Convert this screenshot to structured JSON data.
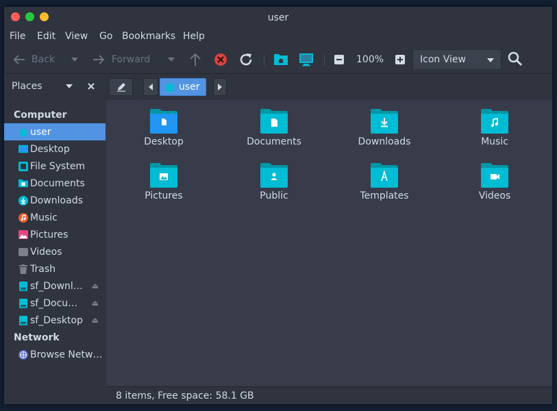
{
  "window": {
    "title": "user"
  },
  "menu": [
    "File",
    "Edit",
    "View",
    "Go",
    "Bookmarks",
    "Help"
  ],
  "toolbar": {
    "back_label": "Back",
    "forward_label": "Forward",
    "zoom": "100%",
    "view_mode": "Icon View"
  },
  "sidebar": {
    "header": "Places",
    "computer_label": "Computer",
    "network_label": "Network",
    "items": [
      {
        "label": "user",
        "icon": "home-icon"
      },
      {
        "label": "Desktop",
        "icon": "desktop-folder-icon"
      },
      {
        "label": "File System",
        "icon": "filesystem-icon"
      },
      {
        "label": "Documents",
        "icon": "documents-folder-icon"
      },
      {
        "label": "Downloads",
        "icon": "downloads-icon"
      },
      {
        "label": "Music",
        "icon": "music-icon"
      },
      {
        "label": "Pictures",
        "icon": "pictures-icon"
      },
      {
        "label": "Videos",
        "icon": "videos-icon"
      },
      {
        "label": "Trash",
        "icon": "trash-icon"
      },
      {
        "label": "sf_Downl…",
        "icon": "drive-icon"
      },
      {
        "label": "sf_Docu…",
        "icon": "drive-icon"
      },
      {
        "label": "sf_Desktop",
        "icon": "drive-icon"
      },
      {
        "label": "Browse Netw…",
        "icon": "network-icon"
      }
    ]
  },
  "pathbar": {
    "current": "user"
  },
  "files": [
    {
      "label": "Desktop",
      "glyph": "desktop"
    },
    {
      "label": "Documents",
      "glyph": "document"
    },
    {
      "label": "Downloads",
      "glyph": "download"
    },
    {
      "label": "Music",
      "glyph": "music"
    },
    {
      "label": "Pictures",
      "glyph": "picture"
    },
    {
      "label": "Public",
      "glyph": "person"
    },
    {
      "label": "Templates",
      "glyph": "template"
    },
    {
      "label": "Videos",
      "glyph": "video"
    }
  ],
  "status": "8 items, Free space: 58.1 GB",
  "colors": {
    "accent": "#5294e2",
    "folder": "#00bcd4",
    "folder_dark": "#0097a7",
    "close": "#ff5f57",
    "minimize": "#28c940",
    "maximize": "#ffbd2e"
  }
}
